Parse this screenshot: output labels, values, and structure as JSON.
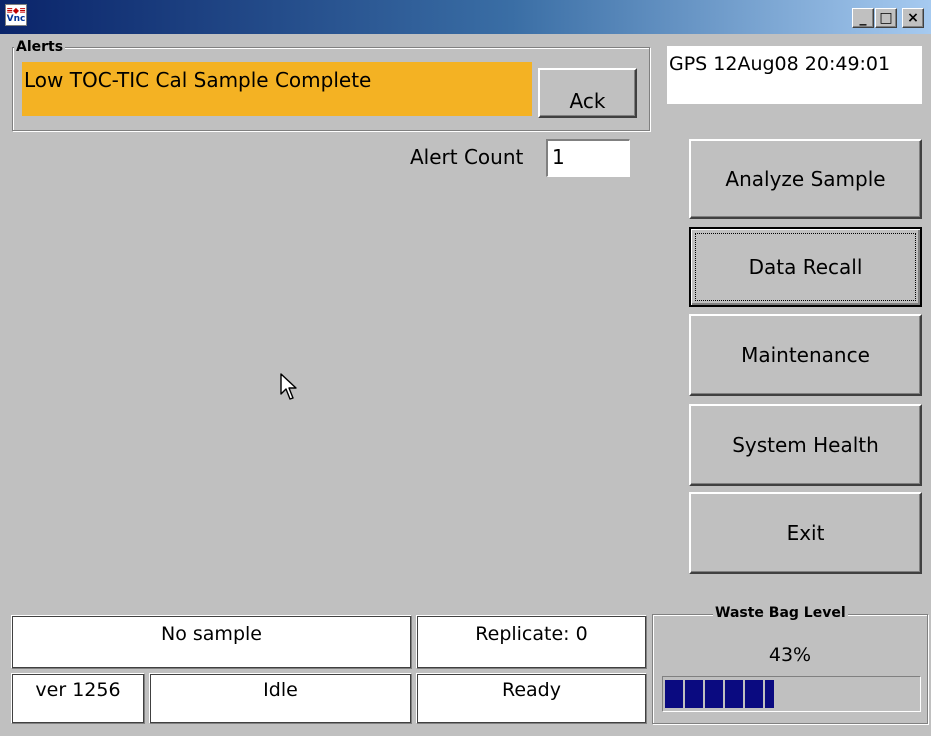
{
  "window": {
    "app_icon_text_top": "≡◆≡",
    "app_icon_text_bottom": "Vnc",
    "minimize_glyph": "_",
    "maximize_glyph": "□",
    "close_glyph": "×"
  },
  "alerts": {
    "group_label": "Alerts",
    "message": "Low TOC-TIC Cal Sample Complete",
    "message_color": "#f4b223",
    "ack_label": "Ack",
    "count_label": "Alert Count",
    "count_value": "1"
  },
  "gps": {
    "text": "GPS 12Aug08 20:49:01"
  },
  "actions": {
    "analyze_sample": "Analyze Sample",
    "data_recall": "Data Recall",
    "maintenance": "Maintenance",
    "system_health": "System Health",
    "exit": "Exit"
  },
  "status": {
    "sample": "No sample",
    "replicate": "Replicate: 0",
    "version": "ver 1256",
    "state": "Idle",
    "readiness": "Ready"
  },
  "waste_bag": {
    "label": "Waste Bag Level",
    "percent_text": "43%",
    "level": 0.43,
    "bar_color": "#0a0a80"
  }
}
